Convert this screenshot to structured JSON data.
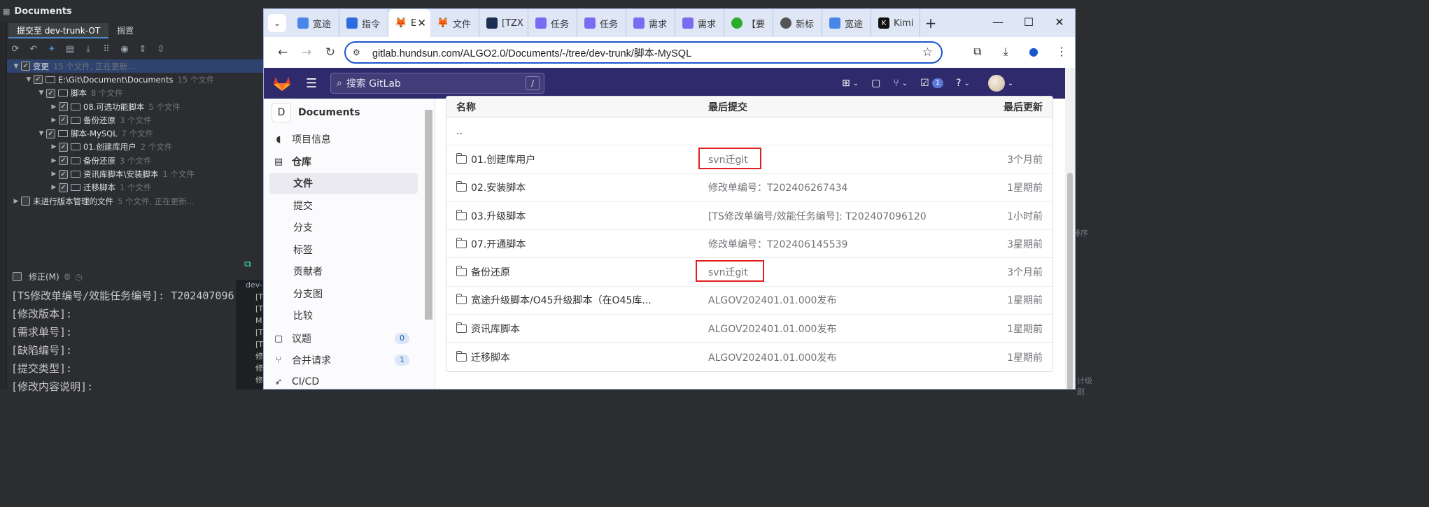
{
  "ide": {
    "title": "Documents",
    "tabs": [
      "提交至 dev-trunk-OT",
      "搁置"
    ],
    "tree": [
      {
        "level": 0,
        "name": "变更",
        "count": "15 个文件, 正在更新...",
        "selected": true
      },
      {
        "level": 1,
        "name": "E:\\Git\\Document\\Documents",
        "count": "15 个文件"
      },
      {
        "level": 2,
        "name": "脚本",
        "count": "8 个文件"
      },
      {
        "level": 3,
        "name": "08.可选功能脚本",
        "count": "5 个文件"
      },
      {
        "level": 3,
        "name": "备份还原",
        "count": "3 个文件"
      },
      {
        "level": 2,
        "name": "脚本-MySQL",
        "count": "7 个文件"
      },
      {
        "level": 3,
        "name": "01.创建库用户",
        "count": "2 个文件"
      },
      {
        "level": 3,
        "name": "备份还原",
        "count": "3 个文件"
      },
      {
        "level": 3,
        "name": "资讯库脚本\\安装脚本",
        "count": "1 个文件"
      },
      {
        "level": 3,
        "name": "迁移脚本",
        "count": "1 个文件"
      },
      {
        "level": 0,
        "name": "未进行版本管理的文件",
        "count": "5 个文件, 正在更新..."
      }
    ],
    "amend_label": "修正(M)",
    "commit_lines": [
      "[TS修改单编号/效能任务编号]: T202407096",
      "[修改版本]:",
      "[需求单号]:",
      "[缺陷编号]:",
      "[提交类型]:",
      "[修改内容说明]:"
    ],
    "sub_panel": {
      "branch": "dev-",
      "lines": [
        "[T",
        "[T",
        "M",
        "[T",
        "[T",
        "修",
        "修",
        "修"
      ]
    },
    "right_fragments": [
      "排序",
      "计级剧"
    ]
  },
  "browser": {
    "tabs": [
      {
        "label": "宽途",
        "icon_color": "#4a86e8",
        "icon": "chrome-tab-icon"
      },
      {
        "label": "指令",
        "icon_color": "#2d6bdf",
        "icon": "confluence-icon"
      },
      {
        "label": "E",
        "icon_color": "#e24329",
        "icon": "gitlab-icon",
        "active": true
      },
      {
        "label": "文件",
        "icon_color": "#e24329",
        "icon": "gitlab-icon"
      },
      {
        "label": "[TZX",
        "icon_color": "#1b2f52",
        "icon": "jira-icon"
      },
      {
        "label": "任务",
        "icon_color": "#7a6cf0",
        "icon": "task-icon"
      },
      {
        "label": "任务",
        "icon_color": "#7a6cf0",
        "icon": "task-icon"
      },
      {
        "label": "需求",
        "icon_color": "#7a6cf0",
        "icon": "task-icon"
      },
      {
        "label": "需求",
        "icon_color": "#7a6cf0",
        "icon": "task-icon"
      },
      {
        "label": "【要",
        "icon_color": "#2aae2a",
        "icon": "wechat-icon"
      },
      {
        "label": "新标",
        "icon_color": "#555555",
        "icon": "globe-icon"
      },
      {
        "label": "宽途",
        "icon_color": "#4a86e8",
        "icon": "chrome-tab-icon"
      },
      {
        "label": "Kimi",
        "icon_color": "#111111",
        "icon": "kimi-icon"
      }
    ],
    "url": "gitlab.hundsun.com/ALGO2.0/Documents/-/tree/dev-trunk/脚本-MySQL"
  },
  "gitlab": {
    "search_placeholder": "搜索 GitLab",
    "search_shortcut": "/",
    "todo_count": "1",
    "project_initial": "D",
    "project_name": "Documents",
    "sidebar": [
      {
        "label": "项目信息",
        "icon": "info-icon"
      },
      {
        "label": "仓库",
        "icon": "document-icon",
        "bold": true
      },
      {
        "label": "文件",
        "sub": true,
        "selected": true
      },
      {
        "label": "提交",
        "sub": true
      },
      {
        "label": "分支",
        "sub": true
      },
      {
        "label": "标签",
        "sub": true
      },
      {
        "label": "贡献者",
        "sub": true
      },
      {
        "label": "分支图",
        "sub": true
      },
      {
        "label": "比较",
        "sub": true
      },
      {
        "label": "议题",
        "icon": "issues-icon",
        "count": "0"
      },
      {
        "label": "合并请求",
        "icon": "merge-request-icon",
        "count": "1"
      },
      {
        "label": "CI/CD",
        "icon": "rocket-icon"
      }
    ],
    "table": {
      "headers": {
        "name": "名称",
        "commit": "最后提交",
        "updated": "最后更新"
      },
      "rows": [
        {
          "name": "..",
          "commit": "",
          "updated": "",
          "parent": true
        },
        {
          "name": "01.创建库用户",
          "commit": "svn迁git",
          "updated": "3个月前",
          "highlight": true
        },
        {
          "name": "02.安装脚本",
          "commit": "修改单编号：T202406267434",
          "updated": "1星期前"
        },
        {
          "name": "03.升级脚本",
          "commit": "[TS修改单编号/效能任务编号]: T202407096120",
          "updated": "1小时前"
        },
        {
          "name": "07.开通脚本",
          "commit": "修改单编号：T202406145539",
          "updated": "3星期前"
        },
        {
          "name": "备份还原",
          "commit": "svn迁git",
          "updated": "3个月前",
          "highlight": true
        },
        {
          "name": "宽途升级脚本/O45升级脚本（在O45库...",
          "commit": "ALGOV202401.01.000发布",
          "updated": "1星期前"
        },
        {
          "name": "资讯库脚本",
          "commit": "ALGOV202401.01.000发布",
          "updated": "1星期前"
        },
        {
          "name": "迁移脚本",
          "commit": "ALGOV202401.01.000发布",
          "updated": "1星期前"
        }
      ]
    }
  },
  "colors": {
    "gitlab_header": "#2f2a6b",
    "highlight_box": "#e02020",
    "omnibox_border": "#1a57c9"
  }
}
